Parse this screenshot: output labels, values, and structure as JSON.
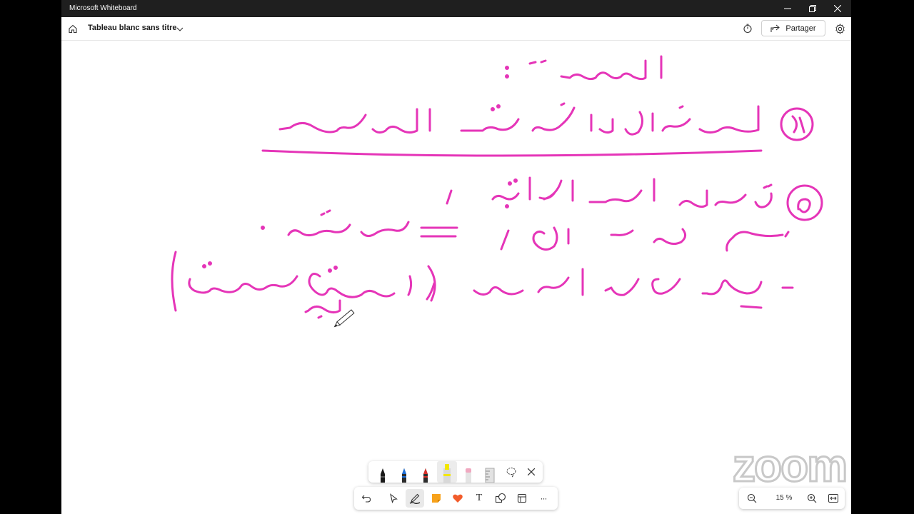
{
  "window": {
    "title": "Microsoft Whiteboard",
    "controls": [
      "minimize-icon",
      "restore-icon",
      "close-icon"
    ]
  },
  "appbar": {
    "board_title": "Tableau blanc sans titre",
    "share_label": "Partager",
    "icons": [
      "home-icon",
      "chevron-down-icon",
      "timer-icon",
      "share-icon",
      "gear-icon"
    ]
  },
  "canvas": {
    "ink_color": "#e535b8",
    "background": "#ffffff"
  },
  "pen_toolbar": {
    "pens": [
      {
        "name": "black-pen",
        "color": "#1a1a1a"
      },
      {
        "name": "blue-pen",
        "color": "#1e6fd9"
      },
      {
        "name": "red-pen",
        "color": "#d9302a"
      },
      {
        "name": "yellow-highlighter",
        "color": "#f2e600"
      },
      {
        "name": "pink-eraser",
        "color": "#f0a8c0"
      },
      {
        "name": "ruler",
        "color": "#bdbdbd"
      }
    ],
    "icons": [
      "lasso-icon",
      "close-icon"
    ]
  },
  "main_toolbar": {
    "tools": [
      "undo-icon",
      "select-icon",
      "pen-icon",
      "sticky-note-icon",
      "reaction-icon",
      "text-icon",
      "shapes-icon",
      "template-icon",
      "more-icon"
    ],
    "selected": "pen-icon",
    "text_tool_glyph": "T",
    "more_glyph": "···"
  },
  "zoom": {
    "level": "15 %",
    "icons": [
      "zoom-out-icon",
      "zoom-in-icon",
      "fit-icon"
    ]
  },
  "watermark": {
    "text": "zoom"
  }
}
